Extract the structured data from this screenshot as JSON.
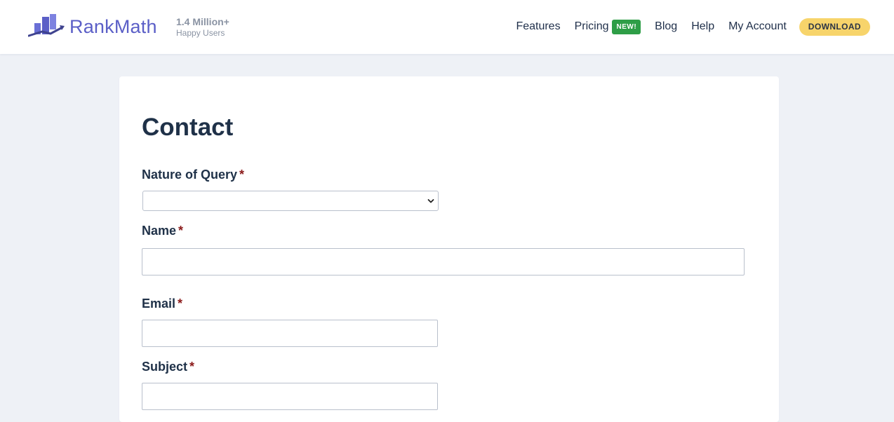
{
  "brand": {
    "name": "RankMath",
    "user_count": "1.4 Million+",
    "user_label": "Happy Users",
    "logo_color": "#5b5fc7"
  },
  "nav": {
    "features": "Features",
    "pricing": "Pricing",
    "pricing_badge": "NEW!",
    "blog": "Blog",
    "help": "Help",
    "account": "My Account",
    "download": "DOWNLOAD"
  },
  "colors": {
    "background": "#eef1f6",
    "badge_green": "#2e9e47",
    "download_yellow": "#f7d46b",
    "required_red": "#8b1a1a",
    "heading": "#1f3148"
  },
  "form": {
    "title": "Contact",
    "required_marker": "*",
    "fields": [
      {
        "label": "Nature of Query",
        "type": "select",
        "value": ""
      },
      {
        "label": "Name",
        "type": "text",
        "value": ""
      },
      {
        "label": "Email",
        "type": "email",
        "value": ""
      },
      {
        "label": "Subject",
        "type": "text",
        "value": ""
      }
    ]
  },
  "icons": [
    "rankmath-logo-icon",
    "chevron-down-icon"
  ]
}
